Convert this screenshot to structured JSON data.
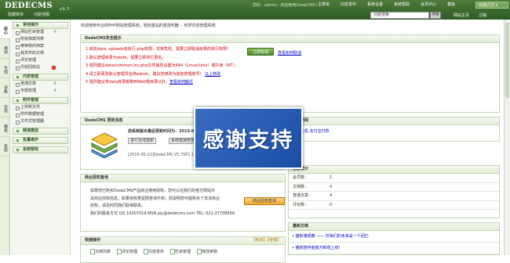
{
  "header": {
    "logo": "DEDECMS",
    "version": "v5.7",
    "userbar": "您好：admin，欢迎使用DedeCMS！",
    "nav": [
      "主菜单",
      "内容发布",
      "系统设置",
      "系统帮助",
      "会员中心",
      "模板"
    ],
    "quick_mode": "快捷方式 ▾",
    "sub": [
      "隐藏菜单",
      "功能地图"
    ],
    "search_placeholder": "功能搜索",
    "search_btn": "搜索",
    "right_links": [
      "网站主页",
      "注销"
    ]
  },
  "vtabs": [
    "核心",
    "模块",
    "生成",
    "采集",
    "会员",
    "模板",
    "系统"
  ],
  "sidebar": {
    "sections": [
      {
        "title": "常用操作",
        "items": [
          "网站栏目管理",
          "所有档案列表",
          "等审核的档案",
          "我发布的文档",
          "评论管理",
          "内容回收站"
        ]
      },
      {
        "title": "内容管理",
        "items": [
          "普通文章",
          "专题管理"
        ]
      },
      {
        "title": "附件管理",
        "items": [
          "上传新文件",
          "附件数据管理",
          "文件式管理器"
        ]
      },
      {
        "title": "频道模型",
        "items": []
      },
      {
        "title": "批量维护",
        "items": []
      },
      {
        "title": "系统帮助",
        "items": []
      }
    ]
  },
  "main": {
    "welcome": "欢迎使用专业的PHP网站管理系统，轻松建站的首选利器 -- 织梦内容管理系统",
    "security": {
      "title": "DedeCMS安全提示",
      "lines": [
        "1.目前data, uploads有执行.php权限，非常危险，需要立即取消目录的执行权限！",
        "2.默认管理目录为dede，需要立即将它更名；",
        "3.强烈建议data/common.inc.php文件属性设置为644（Linux/Unix）或只读（NT）；",
        "4.请立即更改默认管理员名称admin，建议您修改为其他管理帐号！",
        "5.强烈建议将data目录搬移到Web根目录以外；"
      ],
      "links": [
        "查看如何取消",
        "马上修改",
        "查看如何搬迁"
      ],
      "fix_btn": "立即检测",
      "fix_link": "查看如何取消"
    },
    "update": {
      "title": "DedeCMS 更新消息",
      "notice": "您系统版本最后更新时间为：2015-05-22",
      "btn1": "进行在线更新",
      "btn2": "系统错误修复",
      "line": "[2015-05-22]DedeCMS V5.7SP1.1 正式版"
    },
    "license": {
      "title": "商业授权查询",
      "lines": [
        "如果您已购买DedeCMS产品商业使用授权，您可以在我们的官方网站中",
        "关商业授权信息，如果授权类型网查询不到，则说明您可能购买了非法商业",
        "授权，请及时同我们取得联系。",
        "我们的联系方式 QQ 10307019 MSN jay@dedecms.com TEL: 021-37708569"
      ],
      "btn": "商业授权查询"
    },
    "quick": {
      "title": "快捷操作",
      "right": "【新增】【管理】",
      "items": [
        "文档列表",
        "评论管理",
        "内容发布",
        "栏目管理",
        "修改参数"
      ]
    },
    "right_top": {
      "title": "官方新闻",
      "line": "海外主机  支付宝付款"
    },
    "stats": {
      "title": "信息统计",
      "rows": [
        {
          "label": "会员数：",
          "value": "1"
        },
        {
          "label": "文档数：",
          "value": "4"
        },
        {
          "label": "普通文章：",
          "value": "4"
        },
        {
          "label": "评论数：",
          "value": "0"
        }
      ]
    },
    "news": {
      "title": "最新文档",
      "items": [
        "猫新博观察 —— 仅我们的未来是一个回忆",
        "猫新陪伴度度方新增上线!"
      ]
    }
  },
  "overlay": {
    "text": "感谢支持"
  }
}
